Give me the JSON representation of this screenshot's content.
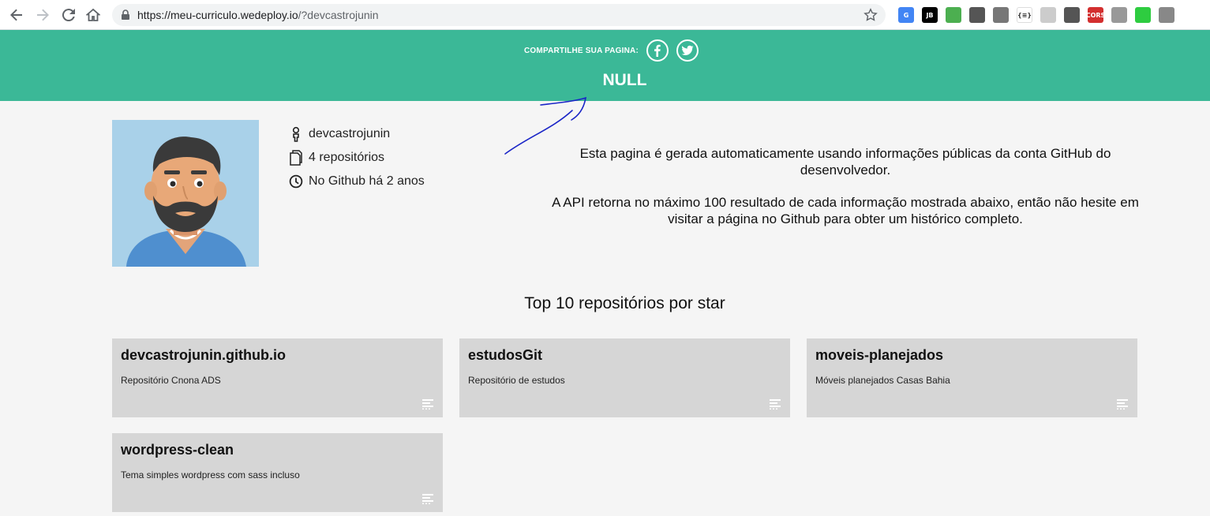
{
  "browser": {
    "url_host": "https://meu-curriculo.wedeploy.io",
    "url_path": "/?devcastrojunin",
    "extensions": [
      {
        "name": "google-translate-icon",
        "color": "#4285f4",
        "text": "G"
      },
      {
        "name": "jetbrains-icon",
        "color": "#000000",
        "text": "JB"
      },
      {
        "name": "download-tray-icon",
        "color": "#4caf50",
        "text": ""
      },
      {
        "name": "gear-icon",
        "color": "#555555",
        "text": ""
      },
      {
        "name": "settings-cog-icon",
        "color": "#777777",
        "text": ""
      },
      {
        "name": "json-viewer-icon",
        "color": "#ffffff",
        "text": "{≡}"
      },
      {
        "name": "chat-icon",
        "color": "#cccccc",
        "text": ""
      },
      {
        "name": "network-icon",
        "color": "#555555",
        "text": ""
      },
      {
        "name": "cors-icon",
        "color": "#d32f2f",
        "text": "CORS"
      },
      {
        "name": "tag-icon",
        "color": "#999999",
        "text": ""
      },
      {
        "name": "thumbs-up-icon",
        "color": "#2ecc40",
        "text": ""
      },
      {
        "name": "camera-icon",
        "color": "#888888",
        "text": ""
      }
    ]
  },
  "header": {
    "share_label": "COMPARTILHE SUA PAGINA:",
    "page_name": "NULL",
    "color": "#3bb897"
  },
  "profile": {
    "username": "devcastrojunin",
    "repos": "4 repositórios",
    "since": "No Github há 2 anos"
  },
  "description": {
    "p1": "Esta pagina é gerada automaticamente usando informações públicas da conta GitHub do desenvolvedor.",
    "p2": "A API retorna no máximo 100 resultado de cada informação mostrada abaixo, então não hesite em visitar a página no Github para obter um histórico completo."
  },
  "section_title": "Top 10 repositórios por star",
  "repos": [
    {
      "name": "devcastrojunin.github.io",
      "description": "Repositório Cnona ADS"
    },
    {
      "name": "estudosGit",
      "description": "Repositório de estudos"
    },
    {
      "name": "moveis-planejados",
      "description": "Móveis planejados Casas Bahia"
    },
    {
      "name": "wordpress-clean",
      "description": "Tema simples wordpress com sass incluso"
    }
  ]
}
